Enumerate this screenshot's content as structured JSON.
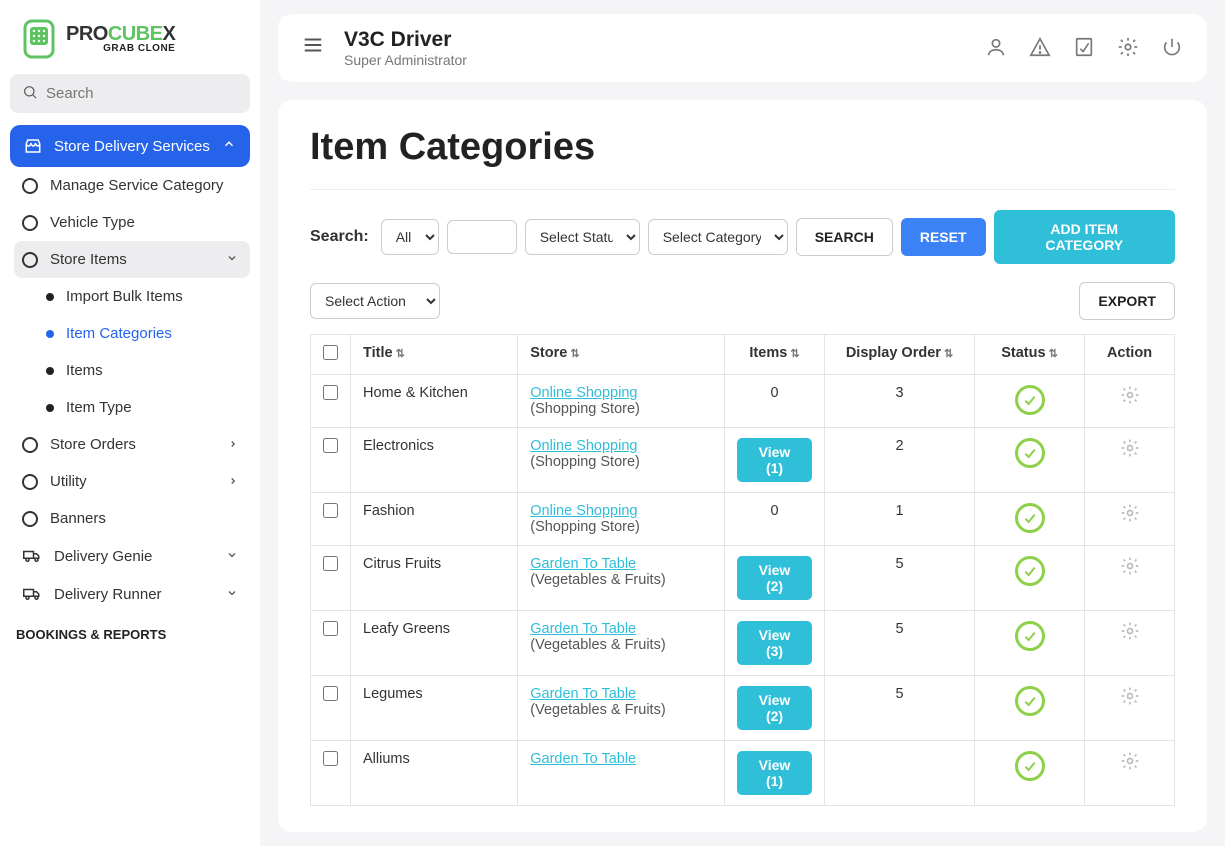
{
  "logo": {
    "main_pre": "PRO",
    "main_mid": "CUBE",
    "main_suf": "X",
    "sub": "GRAB CLONE"
  },
  "search": {
    "placeholder": "Search"
  },
  "sidebar": {
    "active": "Store Delivery Services",
    "items": [
      {
        "label": "Manage Service Category"
      },
      {
        "label": "Vehicle Type"
      },
      {
        "label": "Store Items",
        "group": true,
        "children": [
          {
            "label": "Import Bulk Items"
          },
          {
            "label": "Item Categories",
            "selected": true
          },
          {
            "label": "Items"
          },
          {
            "label": "Item Type"
          }
        ]
      },
      {
        "label": "Store Orders",
        "expandable": true
      },
      {
        "label": "Utility",
        "expandable": true
      },
      {
        "label": "Banners"
      },
      {
        "label": "Delivery Genie",
        "expandable": true,
        "icon": "truck"
      },
      {
        "label": "Delivery Runner",
        "expandable": true,
        "icon": "truck"
      }
    ],
    "section": "BOOKINGS & REPORTS"
  },
  "header": {
    "title": "V3C Driver",
    "role": "Super Administrator"
  },
  "page": {
    "title": "Item Categories"
  },
  "filters": {
    "search_label": "Search:",
    "all_options": [
      "All"
    ],
    "status_options": [
      "Select Status"
    ],
    "category_options": [
      "Select Category"
    ],
    "search_btn": "SEARCH",
    "reset_btn": "RESET",
    "add_btn": "ADD ITEM CATEGORY",
    "action_options": [
      "Select Action"
    ],
    "export_btn": "EXPORT"
  },
  "table": {
    "headers": {
      "title": "Title",
      "store": "Store",
      "items": "Items",
      "order": "Display Order",
      "status": "Status",
      "action": "Action"
    },
    "rows": [
      {
        "title": "Home & Kitchen",
        "store_link": "Online Shopping",
        "store_sub": "(Shopping Store)",
        "items_text": "0",
        "items_is_badge": false,
        "order": "3"
      },
      {
        "title": "Electronics",
        "store_link": "Online Shopping",
        "store_sub": "(Shopping Store)",
        "items_text": "View (1)",
        "items_is_badge": true,
        "order": "2"
      },
      {
        "title": "Fashion",
        "store_link": "Online Shopping",
        "store_sub": "(Shopping Store)",
        "items_text": "0",
        "items_is_badge": false,
        "order": "1"
      },
      {
        "title": "Citrus Fruits",
        "store_link": "Garden To Table",
        "store_sub": "(Vegetables & Fruits)",
        "items_text": "View (2)",
        "items_is_badge": true,
        "order": "5"
      },
      {
        "title": "Leafy Greens",
        "store_link": "Garden To Table",
        "store_sub": "(Vegetables & Fruits)",
        "items_text": "View (3)",
        "items_is_badge": true,
        "order": "5"
      },
      {
        "title": "Legumes",
        "store_link": "Garden To Table",
        "store_sub": "(Vegetables & Fruits)",
        "items_text": "View (2)",
        "items_is_badge": true,
        "order": "5"
      },
      {
        "title": "Alliums",
        "store_link": "Garden To Table",
        "store_sub": "",
        "items_text": "View (1)",
        "items_is_badge": true,
        "order": ""
      }
    ]
  }
}
